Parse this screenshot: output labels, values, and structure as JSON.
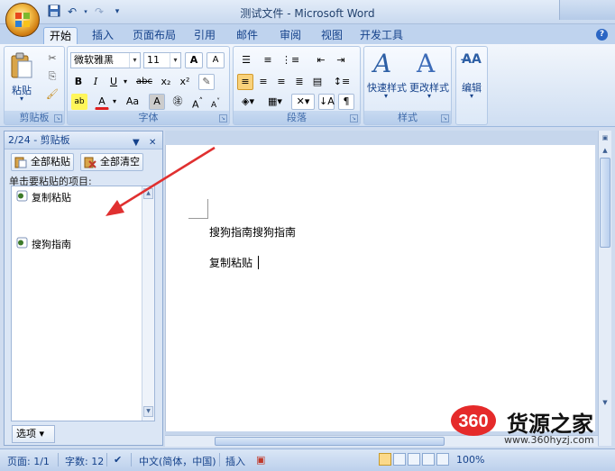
{
  "window": {
    "title": "测试文件 - Microsoft Word"
  },
  "quick_access": {
    "icons": [
      "save-icon",
      "undo-icon",
      "redo-icon",
      "customize-icon"
    ]
  },
  "tabs": [
    "开始",
    "插入",
    "页面布局",
    "引用",
    "邮件",
    "审阅",
    "视图",
    "开发工具"
  ],
  "ribbon": {
    "clipboard": {
      "label": "剪贴板",
      "paste_label": "粘贴"
    },
    "font": {
      "label": "字体",
      "font_name": "微软雅黑",
      "font_size": "11",
      "bold": "B",
      "italic": "I",
      "underline": "U",
      "strike": "abc",
      "subscript": "x₂",
      "superscript": "x²",
      "grow": "A",
      "shrink": "A",
      "change_case": "Aa"
    },
    "paragraph": {
      "label": "段落"
    },
    "styles": {
      "label": "样式",
      "quick_styles": "快速样式",
      "change_styles": "更改样式"
    },
    "editing": {
      "label": "编辑"
    }
  },
  "task_pane": {
    "title": "2/24 - 剪贴板",
    "paste_all": "全部粘贴",
    "clear_all": "全部清空",
    "hint": "单击要粘贴的项目:",
    "items": [
      "复制粘贴",
      "搜狗指南"
    ],
    "options": "选项 ▾"
  },
  "document": {
    "lines": [
      "搜狗指南搜狗指南",
      "复制粘贴"
    ]
  },
  "status_bar": {
    "page": "页面: 1/1",
    "words": "字数: 12",
    "language": "中文(简体，中国)",
    "mode": "插入",
    "zoom": "100%"
  },
  "watermark": {
    "brand": "货源之家",
    "logo_text": "360",
    "url": "www.360hyzj.com"
  }
}
